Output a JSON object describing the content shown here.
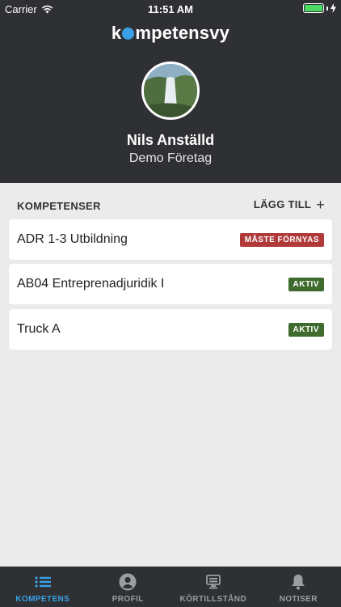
{
  "status_bar": {
    "carrier": "Carrier",
    "time": "11:51 AM"
  },
  "app": {
    "logo_prefix": "k",
    "logo_suffix": "mpetensvy"
  },
  "profile": {
    "name": "Nils Anställd",
    "company": "Demo Företag"
  },
  "competences": {
    "section_title": "KOMPETENSER",
    "add_label": "LÄGG TILL",
    "items": [
      {
        "label": "ADR 1-3 Utbildning",
        "status": "MÅSTE FÖRNYAS",
        "status_color": "#b03a3a"
      },
      {
        "label": "AB04 Entreprenadjuridik I",
        "status": "AKTIV",
        "status_color": "#3f6b2e"
      },
      {
        "label": "Truck A",
        "status": "AKTIV",
        "status_color": "#3f6b2e"
      }
    ]
  },
  "tabbar": {
    "tabs": [
      {
        "label": "KOMPETENS",
        "icon": "list-icon",
        "active": true
      },
      {
        "label": "PROFIL",
        "icon": "user-circle-icon",
        "active": false
      },
      {
        "label": "KÖRTILLSTÅND",
        "icon": "id-card-icon",
        "active": false
      },
      {
        "label": "NOTISER",
        "icon": "bell-icon",
        "active": false
      }
    ]
  },
  "colors": {
    "header_bg": "#2e3033",
    "accent": "#3aa0e6",
    "body_bg": "#ebebeb"
  }
}
